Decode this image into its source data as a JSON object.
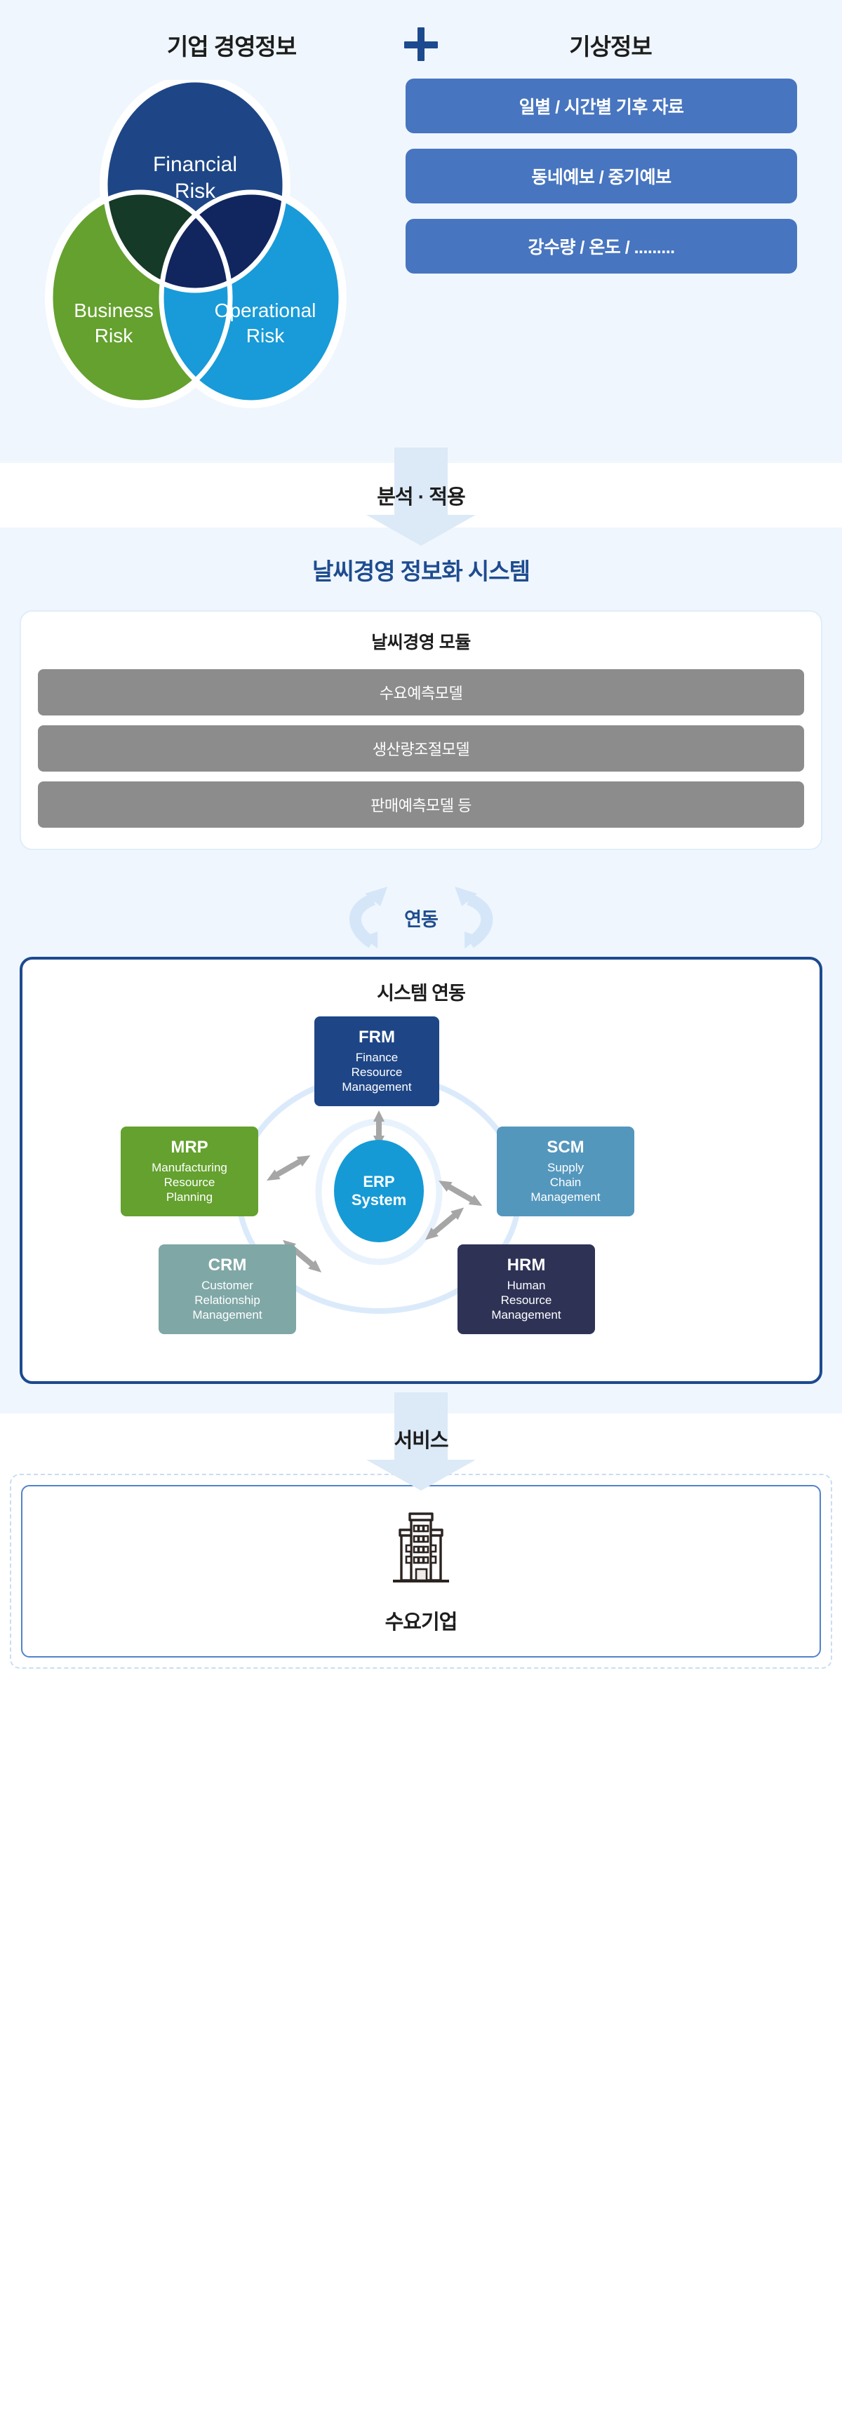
{
  "sources": {
    "left_title": "기업 경영정보",
    "plus_icon": "plus-icon",
    "right_title": "기상정보",
    "venn": {
      "financial": {
        "line1": "Financial",
        "line2": "Risk",
        "color": "#1e4686"
      },
      "business": {
        "line1": "Business",
        "line2": "Risk",
        "color": "#64a12e"
      },
      "operational": {
        "line1": "Operational",
        "line2": "Risk",
        "color": "#189bd8"
      },
      "overlap_fin_bus": "#153a27",
      "overlap_fin_op": "#11265f"
    },
    "weather_items": [
      "일별 / 시간별 기후 자료",
      "동네예보 / 중기예보",
      "강수량 / 온도 / ........."
    ],
    "weather_box_color": "#4775c0"
  },
  "transition_analyze": {
    "label": "분석 · 적용",
    "arrow_icon": "arrow-down-icon",
    "arrow_color": "#dce9f7"
  },
  "system": {
    "title": "날씨경영 정보화 시스템",
    "title_color": "#1e4c8f",
    "module_card_title": "날씨경영 모듈",
    "modules": [
      "수요예측모델",
      "생산량조절모델",
      "판매예측모델 등"
    ],
    "module_color": "#8c8c8c"
  },
  "transition_link": {
    "label": "연동",
    "left_icon": "curved-arrow-up-icon",
    "right_icon": "curved-arrow-down-icon",
    "icon_color": "#d5e6f9"
  },
  "erp": {
    "title": "시스템 연동",
    "border_color": "#1c4a8f",
    "center": {
      "line1": "ERP",
      "line2": "System",
      "color": "#159ad6"
    },
    "nodes": [
      {
        "key": "frm",
        "abbr": "FRM",
        "line1": "Finance",
        "line2": "Resource",
        "line3": "Management",
        "color": "#1e4686"
      },
      {
        "key": "mrp",
        "abbr": "MRP",
        "line1": "Manufacturing",
        "line2": "Resource",
        "line3": "Planning",
        "color": "#64a12e"
      },
      {
        "key": "scm",
        "abbr": "SCM",
        "line1": "Supply",
        "line2": "Chain",
        "line3": "Management",
        "color": "#5497bd"
      },
      {
        "key": "crm",
        "abbr": "CRM",
        "line1": "Customer",
        "line2": "Relationship",
        "line3": "Management",
        "color": "#7fa7a6"
      },
      {
        "key": "hrm",
        "abbr": "HRM",
        "line1": "Human",
        "line2": "Resource",
        "line3": "Management",
        "color": "#2e3356"
      }
    ],
    "connector_icon": "double-headed-arrow-icon",
    "connector_color": "#a6a6a6",
    "orbit_color": "#dbeafb"
  },
  "transition_service": {
    "label": "서비스",
    "arrow_icon": "arrow-down-icon",
    "arrow_color": "#dce9f7"
  },
  "consumer": {
    "icon": "office-building-icon",
    "label": "수요기업",
    "frame_color": "#5183cb",
    "dashed_color": "#c9ddf3"
  }
}
